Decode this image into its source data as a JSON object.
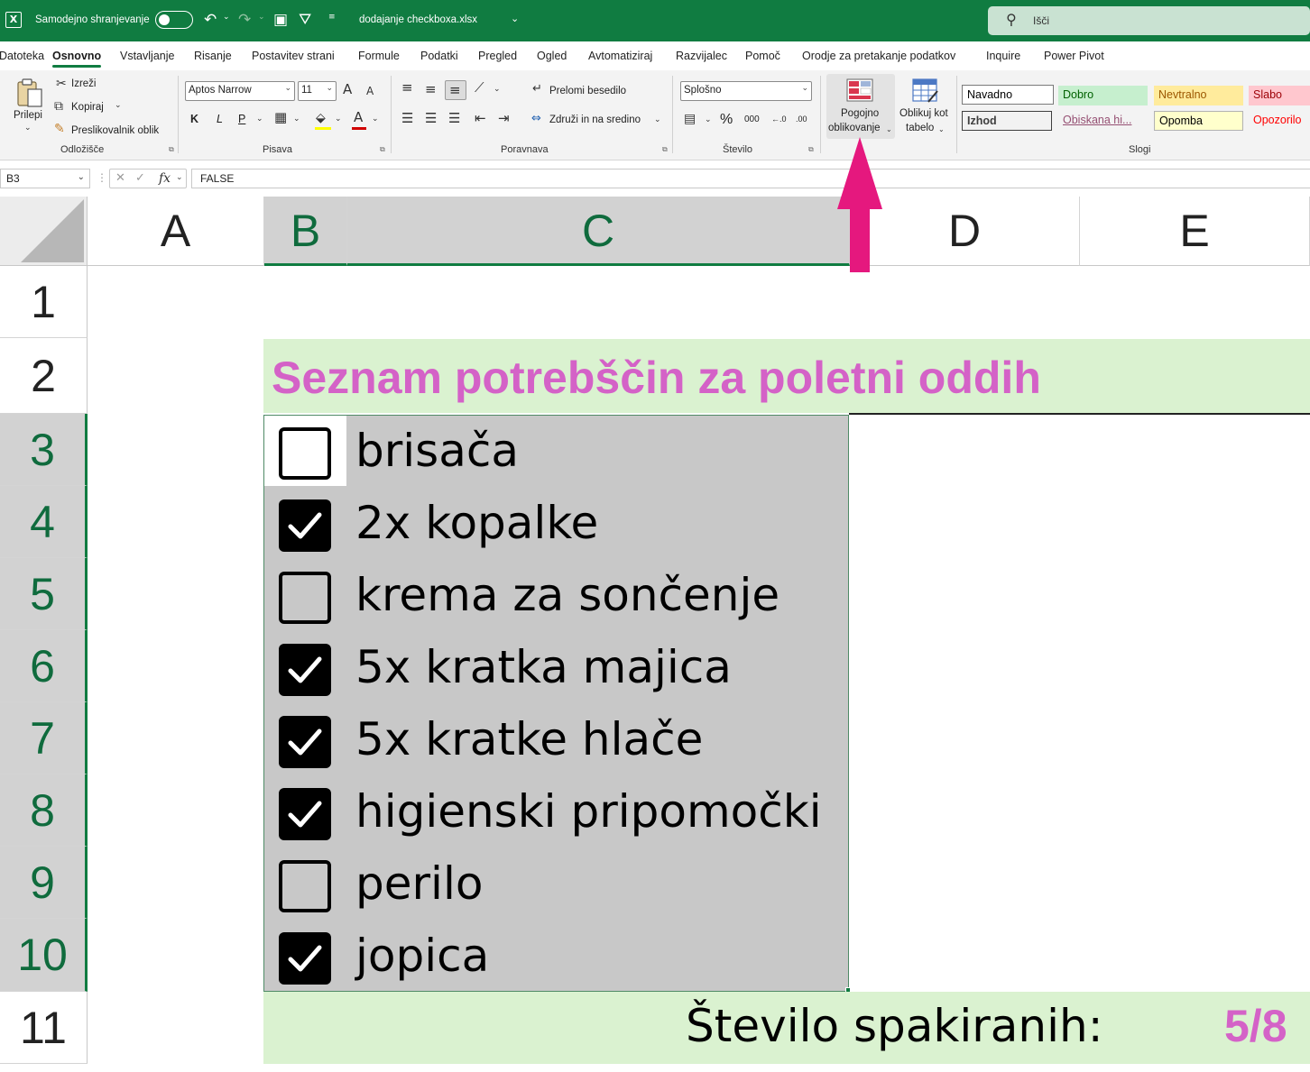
{
  "titlebar": {
    "autosave_label": "Samodejno shranjevanje",
    "filename": "dodajanje checkboxa.xlsx",
    "search_placeholder": "Išči",
    "logo": "X",
    "undo_icon": "↶",
    "redo_icon": "↷",
    "save_icon": "▣",
    "filter_icon": "⛛",
    "more_icon": "≡",
    "caret": "⌄",
    "search_glyph": "⚲"
  },
  "menu": {
    "tabs": [
      "Datoteka",
      "Osnovno",
      "Vstavljanje",
      "Risanje",
      "Postavitev strani",
      "Formule",
      "Podatki",
      "Pregled",
      "Ogled",
      "Avtomatiziraj",
      "Razvijalec",
      "Pomoč",
      "Orodje za pretakanje podatkov",
      "Inquire",
      "Power Pivot"
    ],
    "active_index": 1
  },
  "ribbon": {
    "clipboard": {
      "paste": "Prilepi",
      "cut": "Izreži",
      "copy": "Kopiraj",
      "format_painter": "Preslikovalnik oblik",
      "group": "Odložišče"
    },
    "font": {
      "name": "Aptos Narrow",
      "size": "11",
      "bold": "K",
      "italic": "L",
      "underline": "P",
      "grow": "A",
      "shrink": "A",
      "font_color_glyph": "A",
      "group": "Pisava"
    },
    "alignment": {
      "wrap": "Prelomi besedilo",
      "merge": "Združi in na sredino",
      "group": "Poravnava"
    },
    "number": {
      "format": "Splošno",
      "percent": "%",
      "thousands": "000",
      "inc_decimals": "←.0",
      "dec_decimals": ".00",
      "group": "Število"
    },
    "styles": {
      "conditional_line1": "Pogojno",
      "conditional_line2": "oblikovanje",
      "table_line1": "Oblikuj kot",
      "table_line2": "tabelo",
      "cells": [
        "Navadno",
        "Dobro",
        "Nevtralno",
        "Slabo",
        "Izhod",
        "Obiskana hi...",
        "Opomba",
        "Opozorilo"
      ],
      "group": "Slogi"
    },
    "launcher_glyph": "⧉"
  },
  "formula_bar": {
    "cell_ref": "B3",
    "value": "FALSE",
    "cancel": "✕",
    "enter": "✓",
    "fx": "fx",
    "dots": "⋮"
  },
  "sheet": {
    "columns": [
      "A",
      "B",
      "C",
      "D",
      "E"
    ],
    "rows": [
      "1",
      "2",
      "3",
      "4",
      "5",
      "6",
      "7",
      "8",
      "9",
      "10",
      "11"
    ],
    "title": "Seznam potrebščin za poletni oddih",
    "items": [
      {
        "label": "brisača",
        "checked": false
      },
      {
        "label": "2x kopalke",
        "checked": true
      },
      {
        "label": "krema za sončenje",
        "checked": false
      },
      {
        "label": "5x kratka majica",
        "checked": true
      },
      {
        "label": "5x kratke hlače",
        "checked": true
      },
      {
        "label": "higienski pripomočki",
        "checked": true
      },
      {
        "label": "perilo",
        "checked": false
      },
      {
        "label": "jopica",
        "checked": true
      }
    ],
    "count_label": "Število spakiranih:",
    "count_value": "5/8"
  },
  "colors": {
    "excel_green": "#107c41",
    "title_pink": "#d462c7",
    "band_green": "#daf2d0",
    "list_gray": "#c8c8c8",
    "arrow_pink": "#e5187e"
  }
}
